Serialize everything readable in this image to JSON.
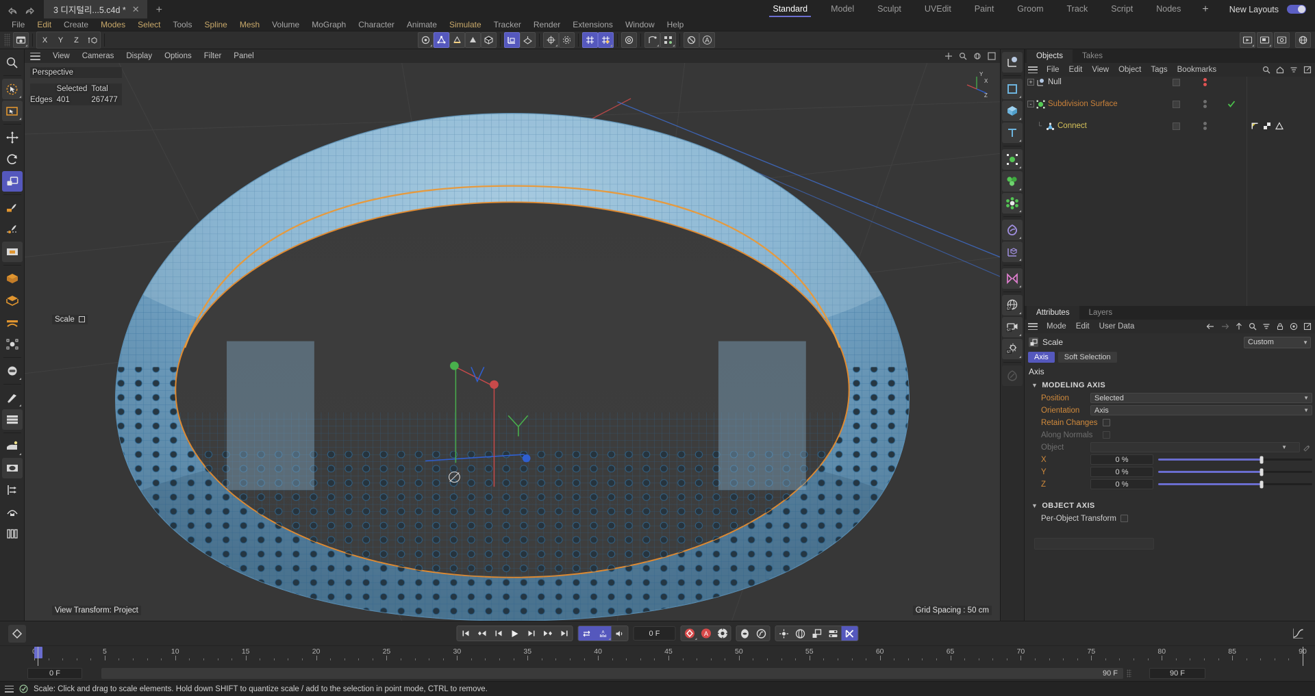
{
  "titlebar": {
    "undo_icon": "undo-arrow-icon",
    "redo_icon": "redo-arrow-icon",
    "file_tab": "3 디지털리...5.c4d *",
    "close_glyph": "✕",
    "new_tab_glyph": "+",
    "layouts": [
      {
        "label": "Standard",
        "active": true
      },
      {
        "label": "Model",
        "active": false
      },
      {
        "label": "Sculpt",
        "active": false
      },
      {
        "label": "UVEdit",
        "active": false
      },
      {
        "label": "Paint",
        "active": false
      },
      {
        "label": "Groom",
        "active": false
      },
      {
        "label": "Track",
        "active": false
      },
      {
        "label": "Script",
        "active": false
      },
      {
        "label": "Nodes",
        "active": false
      }
    ],
    "layout_plus": "+",
    "new_layouts_label": "New Layouts"
  },
  "menubar": [
    {
      "label": "File",
      "highlight": false
    },
    {
      "label": "Edit",
      "highlight": true
    },
    {
      "label": "Create",
      "highlight": false
    },
    {
      "label": "Modes",
      "highlight": true
    },
    {
      "label": "Select",
      "highlight": true
    },
    {
      "label": "Tools",
      "highlight": false
    },
    {
      "label": "Spline",
      "highlight": true
    },
    {
      "label": "Mesh",
      "highlight": true
    },
    {
      "label": "Volume",
      "highlight": false
    },
    {
      "label": "MoGraph",
      "highlight": false
    },
    {
      "label": "Character",
      "highlight": false
    },
    {
      "label": "Animate",
      "highlight": false
    },
    {
      "label": "Simulate",
      "highlight": true
    },
    {
      "label": "Tracker",
      "highlight": false
    },
    {
      "label": "Render",
      "highlight": false
    },
    {
      "label": "Extensions",
      "highlight": false
    },
    {
      "label": "Window",
      "highlight": false
    },
    {
      "label": "Help",
      "highlight": false
    }
  ],
  "main_toolbar": {
    "axis_buttons": [
      "X",
      "Y",
      "Z"
    ],
    "icons": [
      "undo-history-icon",
      "move-axis-lock-icon",
      "point-mode-icon",
      "edge-mode-icon",
      "polygon-mode-icon",
      "model-mode-icon",
      "object-axis-icon",
      "texture-axis-icon",
      "workplane-icon",
      "enable-axis-icon",
      "snap-icon",
      "quantize-icon",
      "grid-snap-icon",
      "world-snap-icon",
      "deformer-icon",
      "array-icon",
      "null-icon",
      "annotation-icon",
      "render-view-icon",
      "render-region-icon",
      "render-settings-icon",
      "content-browser-icon"
    ]
  },
  "left_toolbar": [
    {
      "name": "search-tool",
      "selected": false
    },
    {
      "name": "live-selection-tool",
      "selected": false
    },
    {
      "name": "rectangle-selection-tool",
      "selected": false
    },
    {
      "name": "move-tool",
      "selected": false
    },
    {
      "name": "rotate-tool",
      "selected": false
    },
    {
      "name": "scale-tool",
      "selected": true
    },
    {
      "name": "brush-tool",
      "selected": false
    },
    {
      "name": "magnet-tool",
      "selected": false
    },
    {
      "name": "workplane-tool",
      "selected": false
    },
    {
      "name": "extrude-tool",
      "selected": false
    },
    {
      "name": "inner-extrude-tool",
      "selected": false
    },
    {
      "name": "bridge-tool",
      "selected": false
    },
    {
      "name": "polygon-pen-tool",
      "selected": false
    },
    {
      "name": "mirror-tool",
      "selected": false
    },
    {
      "name": "knife-tool",
      "selected": false
    },
    {
      "name": "loop-cut-tool",
      "selected": false
    },
    {
      "name": "iron-smooth-tool",
      "selected": false
    },
    {
      "name": "uv-tool",
      "selected": false
    },
    {
      "name": "align-tool",
      "selected": false
    },
    {
      "name": "sculpt-tool",
      "selected": false
    },
    {
      "name": "layout-tool",
      "selected": false
    }
  ],
  "right_toolbar": [
    {
      "name": "object-axis-icon"
    },
    {
      "name": "primitive-plane-icon"
    },
    {
      "name": "primitive-cube-icon"
    },
    {
      "name": "text-spline-icon"
    },
    {
      "name": "mograph-cloner-icon"
    },
    {
      "name": "mograph-effector-icon"
    },
    {
      "name": "mograph-field-icon"
    },
    {
      "name": "deformer-bend-icon"
    },
    {
      "name": "environment-axis-icon"
    },
    {
      "name": "generator-symmetry-icon"
    },
    {
      "name": "scene-environment-icon"
    },
    {
      "name": "scene-camera-icon"
    },
    {
      "name": "scene-light-icon"
    },
    {
      "name": "material-paint-icon"
    }
  ],
  "viewport": {
    "menu": [
      "View",
      "Cameras",
      "Display",
      "Options",
      "Filter",
      "Panel"
    ],
    "burger_icon": "hamburger-icon",
    "view_name": "Perspective",
    "stats_headers": [
      "",
      "Selected",
      "Total"
    ],
    "stats_rows": [
      {
        "label": "Edges",
        "selected": "401",
        "total": "267477"
      }
    ],
    "active_tool_label": "Scale",
    "bottom_left": "View Transform: Project",
    "bottom_right": "Grid Spacing : 50 cm",
    "axis_gizmo_labels": [
      "Y",
      "X",
      "Z"
    ],
    "header_right_icons": [
      "pan-view-icon",
      "zoom-view-icon",
      "rotate-view-icon",
      "maximize-view-icon"
    ]
  },
  "object_manager": {
    "tabs": [
      {
        "label": "Objects",
        "active": true
      },
      {
        "label": "Takes",
        "active": false
      }
    ],
    "menu": [
      "File",
      "Edit",
      "View",
      "Object",
      "Tags",
      "Bookmarks"
    ],
    "menu_right_icons": [
      "search-icon",
      "home-icon",
      "filter-icon",
      "detach-icon"
    ],
    "rows": [
      {
        "name": "Null",
        "icon": "null-object-icon",
        "color": "default",
        "expander": "+",
        "indent": 0,
        "dots": [
          "red",
          "red"
        ],
        "tags": []
      },
      {
        "name": "Subdivision Surface",
        "icon": "subdivision-surface-icon",
        "color": "orange",
        "expander": "-",
        "indent": 0,
        "dots": [
          "grey",
          "grey"
        ],
        "check": true,
        "tags": []
      },
      {
        "name": "Connect",
        "icon": "connect-object-icon",
        "color": "yellow",
        "expander": "",
        "indent": 1,
        "dots": [
          "grey",
          "grey"
        ],
        "tags": [
          "phong-tag-icon",
          "texture-tag-icon",
          "display-tag-icon"
        ]
      }
    ]
  },
  "attributes": {
    "tabs": [
      {
        "label": "Attributes",
        "active": true
      },
      {
        "label": "Layers",
        "active": false
      }
    ],
    "menu": [
      "Mode",
      "Edit",
      "User Data"
    ],
    "menu_right_icons": [
      "back-arrow-icon",
      "forward-arrow-icon",
      "up-arrow-icon",
      "search-icon",
      "filter-icon",
      "lock-icon",
      "target-icon",
      "detach-icon"
    ],
    "object_icon": "scale-tool-icon",
    "object_name": "Scale",
    "preset_combo": "Custom",
    "tabs_row": [
      {
        "label": "Axis",
        "selected": true
      },
      {
        "label": "Soft Selection",
        "selected": false
      }
    ],
    "section_title": "Axis",
    "groups": [
      {
        "title": "MODELING AXIS",
        "rows": [
          {
            "label": "Position",
            "type": "dropdown",
            "value": "Selected",
            "dim": false
          },
          {
            "label": "Orientation",
            "type": "dropdown",
            "value": "Axis",
            "dim": false
          },
          {
            "label": "Retain Changes",
            "type": "checkbox",
            "value": "",
            "dim": false
          },
          {
            "label": "Along Normals",
            "type": "checkbox",
            "value": "",
            "dim": true
          },
          {
            "label": "Object",
            "type": "link",
            "value": "",
            "dim": true
          },
          {
            "label": "X",
            "type": "slider",
            "value": "0 %",
            "dim": false
          },
          {
            "label": "Y",
            "type": "slider",
            "value": "0 %",
            "dim": false
          },
          {
            "label": "Z",
            "type": "slider",
            "value": "0 %",
            "dim": false
          }
        ]
      },
      {
        "title": "OBJECT AXIS",
        "rows": [
          {
            "label": "Per-Object Transform",
            "type": "checkbox-wide",
            "value": "",
            "dim": false
          }
        ]
      }
    ]
  },
  "timeline": {
    "key_button_icon": "keyframe-diamond-icon",
    "transport": [
      {
        "name": "go-to-start-button",
        "glyph": "start"
      },
      {
        "name": "previous-key-button",
        "glyph": "prevkey"
      },
      {
        "name": "previous-frame-button",
        "glyph": "prevframe"
      },
      {
        "name": "play-button",
        "glyph": "play"
      },
      {
        "name": "next-frame-button",
        "glyph": "nextframe"
      },
      {
        "name": "next-key-button",
        "glyph": "nextkey"
      },
      {
        "name": "go-to-end-button",
        "glyph": "end"
      }
    ],
    "loop_group": [
      {
        "name": "loop-playback-button",
        "active": true
      },
      {
        "name": "animation-sound-button",
        "active": true
      },
      {
        "name": "sound-toggle-button",
        "active": false
      }
    ],
    "current_frame": "0 F",
    "record_group": [
      {
        "name": "record-active-objects-button",
        "active_red": true
      },
      {
        "name": "autokeying-button",
        "active_red": true
      },
      {
        "name": "keyframe-selection-button",
        "active_red": false
      }
    ],
    "pos_group": [
      {
        "name": "point-level-animation-button"
      },
      {
        "name": "parameter-animation-button"
      }
    ],
    "xform_group": [
      {
        "name": "position-key-button"
      },
      {
        "name": "rotation-key-button"
      },
      {
        "name": "scale-key-button"
      },
      {
        "name": "parameter-key-button"
      },
      {
        "name": "pla-key-button",
        "active": true
      }
    ],
    "right_icon": "curve-editor-icon",
    "ruler_labels": [
      "0",
      "5",
      "10",
      "15",
      "20",
      "25",
      "30",
      "35",
      "40",
      "45",
      "50",
      "55",
      "60",
      "65",
      "70",
      "75",
      "80",
      "85",
      "90"
    ],
    "ruler_min": 0,
    "ruler_max": 90,
    "playhead_frame": 0,
    "start_frame_field": "0 F",
    "preview_min_field": "0 F",
    "preview_max_field": "90 F",
    "end_frame_field": "90 F"
  },
  "statusbar": {
    "burger_icon": "hamburger-icon",
    "status_icon": "checkmark-circle-icon",
    "message": "Scale: Click and drag to scale elements. Hold down SHIFT to quantize scale / add to the selection in point mode, CTRL to remove."
  },
  "colors": {
    "accent": "#5558bd",
    "label_orange": "#d08a3c",
    "panel_bg": "#2b2b2b",
    "viewport_bg": "#373737",
    "mesh_blue": "#4a8fc0",
    "highlight_orange": "#e08a30"
  }
}
